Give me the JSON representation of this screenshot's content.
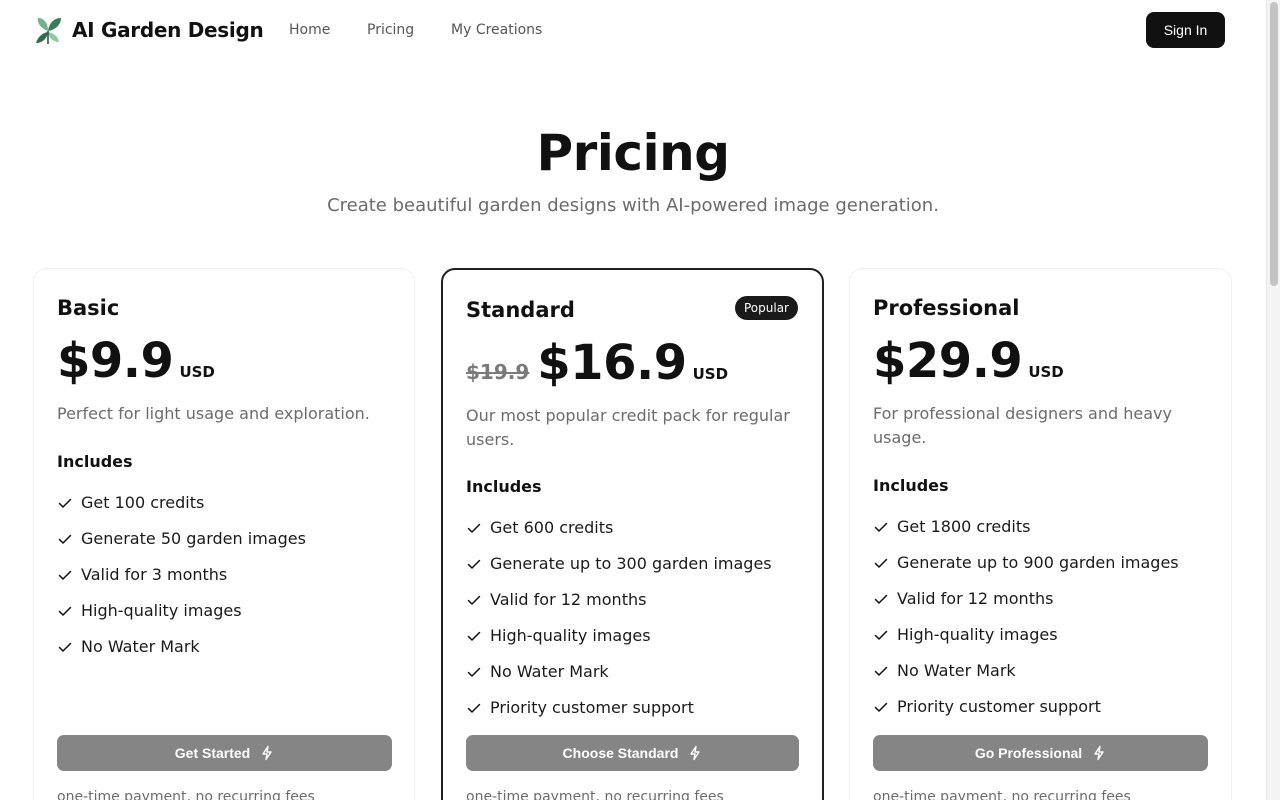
{
  "header": {
    "brand": "AI Garden Design",
    "logo_icon": "leaf-logo-icon",
    "nav": [
      {
        "label": "Home"
      },
      {
        "label": "Pricing"
      },
      {
        "label": "My Creations"
      }
    ],
    "signin_label": "Sign In"
  },
  "hero": {
    "title": "Pricing",
    "subtitle": "Create beautiful garden designs with AI-powered image generation."
  },
  "plans": [
    {
      "name": "Basic",
      "price": "$9.9",
      "currency": "USD",
      "description": "Perfect for light usage and exploration.",
      "includes_label": "Includes",
      "features": [
        "Get 100 credits",
        "Generate 50 garden images",
        "Valid for 3 months",
        "High-quality images",
        "No Water Mark"
      ],
      "cta_label": "Get Started",
      "note": "one-time payment, no recurring fees"
    },
    {
      "name": "Standard",
      "badge": "Popular",
      "old_price": "$19.9",
      "price": "$16.9",
      "currency": "USD",
      "description": "Our most popular credit pack for regular users.",
      "includes_label": "Includes",
      "features": [
        "Get 600 credits",
        "Generate up to 300 garden images",
        "Valid for 12 months",
        "High-quality images",
        "No Water Mark",
        "Priority customer support"
      ],
      "cta_label": "Choose Standard",
      "note": "one-time payment, no recurring fees"
    },
    {
      "name": "Professional",
      "price": "$29.9",
      "currency": "USD",
      "description": "For professional designers and heavy usage.",
      "includes_label": "Includes",
      "features": [
        "Get 1800 credits",
        "Generate up to 900 garden images",
        "Valid for 12 months",
        "High-quality images",
        "No Water Mark",
        "Priority customer support"
      ],
      "cta_label": "Go Professional",
      "note": "one-time payment, no recurring fees"
    }
  ],
  "colors": {
    "primary": "#111111",
    "cta": "#858585",
    "muted_text": "#6b6b6b",
    "logo_green": "#3a7d5c"
  }
}
